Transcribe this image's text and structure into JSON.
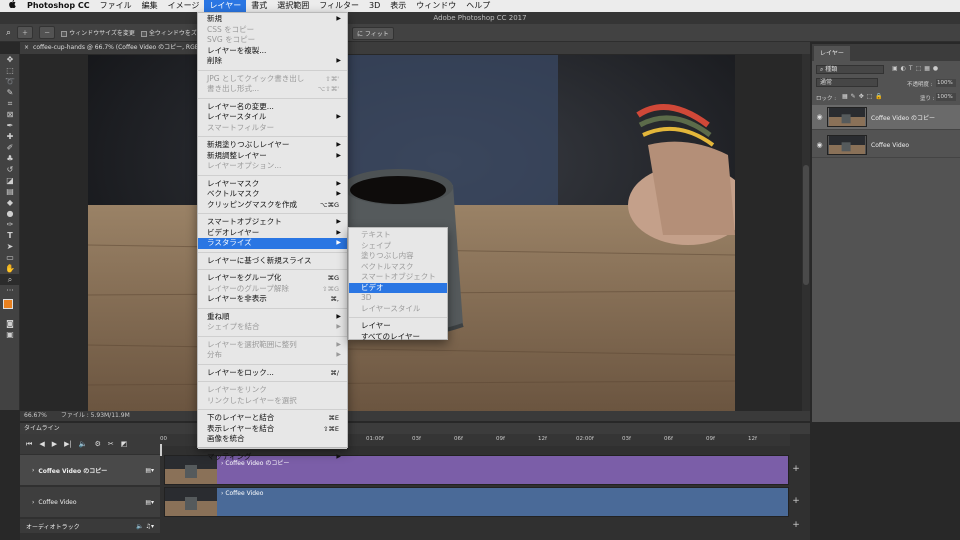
{
  "menubar": {
    "apple": "",
    "app_name": "Photoshop CC",
    "items": [
      "ファイル",
      "編集",
      "イメージ",
      "レイヤー",
      "書式",
      "選択範囲",
      "フィルター",
      "3D",
      "表示",
      "ウィンドウ",
      "ヘルプ"
    ]
  },
  "window_title": "Adobe Photoshop CC 2017",
  "options_bar": {
    "resize_windows": "ウィンドウサイズを変更",
    "all_windows_partial": "全ウィンドウをズ",
    "fit_screen_partial": "に フィット"
  },
  "document_tab": "coffee-cup-hands @ 66.7% (Coffee Video のコピー, RGB",
  "status_bar": {
    "zoom": "66.67%",
    "file": "ファイル : 5.93M/11.9M"
  },
  "layers_panel": {
    "tab": "レイヤー",
    "filter_kind": "種類",
    "blend_mode": "通常",
    "opacity_label": "不透明度 :",
    "opacity_value": "100%",
    "lock_label": "ロック :",
    "fill_label": "塗り :",
    "fill_value": "100%",
    "layers": [
      {
        "name": "Coffee Video のコピー",
        "selected": true
      },
      {
        "name": "Coffee Video",
        "selected": false
      }
    ]
  },
  "timeline": {
    "title": "タイムライン",
    "ruler_ticks": [
      "00",
      "03f",
      "06f",
      "09f",
      "12f",
      "01:00f",
      "03f",
      "06f",
      "09f",
      "12f",
      "02:00f",
      "03f",
      "06f",
      "09f",
      "12f"
    ],
    "tracks": [
      {
        "name": "Coffee Video のコピー",
        "clip": "Coffee Video のコピー",
        "color": "#7b5ea8"
      },
      {
        "name": "Coffee Video",
        "clip": "Coffee Video",
        "color": "#4a6a98"
      }
    ],
    "audio_track": "オーディオトラック"
  },
  "layer_menu": {
    "items": [
      {
        "label": "新規",
        "submenu": true
      },
      {
        "label": "CSS をコピー",
        "disabled": true
      },
      {
        "label": "SVG をコピー",
        "disabled": true
      },
      {
        "label": "レイヤーを複製..."
      },
      {
        "label": "削除",
        "submenu": true
      },
      {
        "sep": true
      },
      {
        "label": "JPG としてクイック書き出し",
        "shortcut": "⇧⌘'",
        "disabled": true
      },
      {
        "label": "書き出し形式...",
        "shortcut": "⌥⇧⌘'",
        "disabled": true
      },
      {
        "sep": true
      },
      {
        "label": "レイヤー名の変更..."
      },
      {
        "label": "レイヤースタイル",
        "submenu": true
      },
      {
        "label": "スマートフィルター",
        "disabled": true
      },
      {
        "sep": true
      },
      {
        "label": "新規塗りつぶしレイヤー",
        "submenu": true
      },
      {
        "label": "新規調整レイヤー",
        "submenu": true
      },
      {
        "label": "レイヤーオプション...",
        "disabled": true
      },
      {
        "sep": true
      },
      {
        "label": "レイヤーマスク",
        "submenu": true
      },
      {
        "label": "ベクトルマスク",
        "submenu": true
      },
      {
        "label": "クリッピングマスクを作成",
        "shortcut": "⌥⌘G"
      },
      {
        "sep": true
      },
      {
        "label": "スマートオブジェクト",
        "submenu": true
      },
      {
        "label": "ビデオレイヤー",
        "submenu": true
      },
      {
        "label": "ラスタライズ",
        "submenu": true,
        "highlighted": true
      },
      {
        "sep": true
      },
      {
        "label": "レイヤーに基づく新規スライス"
      },
      {
        "sep": true
      },
      {
        "label": "レイヤーをグループ化",
        "shortcut": "⌘G"
      },
      {
        "label": "レイヤーのグループ解除",
        "shortcut": "⇧⌘G",
        "disabled": true
      },
      {
        "label": "レイヤーを非表示",
        "shortcut": "⌘,"
      },
      {
        "sep": true
      },
      {
        "label": "重ね順",
        "submenu": true
      },
      {
        "label": "シェイプを結合",
        "submenu": true,
        "disabled": true
      },
      {
        "sep": true
      },
      {
        "label": "レイヤーを選択範囲に整列",
        "submenu": true,
        "disabled": true
      },
      {
        "label": "分布",
        "submenu": true,
        "disabled": true
      },
      {
        "sep": true
      },
      {
        "label": "レイヤーをロック...",
        "shortcut": "⌘/"
      },
      {
        "sep": true
      },
      {
        "label": "レイヤーをリンク",
        "disabled": true
      },
      {
        "label": "リンクしたレイヤーを選択",
        "disabled": true
      },
      {
        "sep": true
      },
      {
        "label": "下のレイヤーと結合",
        "shortcut": "⌘E"
      },
      {
        "label": "表示レイヤーを結合",
        "shortcut": "⇧⌘E"
      },
      {
        "label": "画像を統合"
      },
      {
        "sep": true
      },
      {
        "label": "マッティング",
        "submenu": true
      }
    ]
  },
  "rasterize_submenu": {
    "items": [
      {
        "label": "テキスト",
        "disabled": true
      },
      {
        "label": "シェイプ",
        "disabled": true
      },
      {
        "label": "塗りつぶし内容",
        "disabled": true
      },
      {
        "label": "ベクトルマスク",
        "disabled": true
      },
      {
        "label": "スマートオブジェクト",
        "disabled": true
      },
      {
        "label": "ビデオ",
        "highlighted": true
      },
      {
        "label": "3D",
        "disabled": true
      },
      {
        "label": "レイヤースタイル",
        "disabled": true
      },
      {
        "sep": true
      },
      {
        "label": "レイヤー"
      },
      {
        "label": "すべてのレイヤー"
      }
    ]
  },
  "colors": {
    "accent": "#2a76e3",
    "foreground_swatch": "#e8801e",
    "purple_track": "#7b5ea8",
    "blue_track": "#4a6a98"
  }
}
